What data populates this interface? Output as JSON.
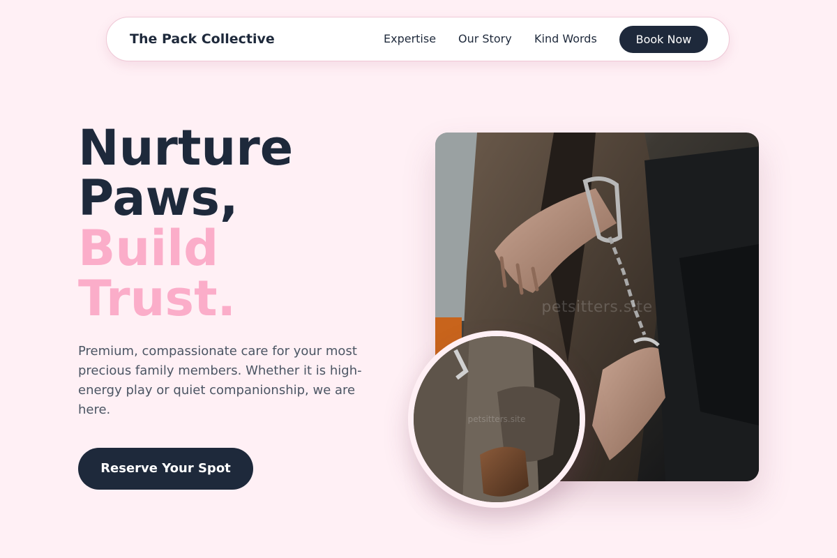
{
  "nav": {
    "brand": "The Pack Collective",
    "links": [
      {
        "label": "Expertise"
      },
      {
        "label": "Our Story"
      },
      {
        "label": "Kind Words"
      }
    ],
    "cta_label": "Book Now"
  },
  "hero": {
    "headline_lines": [
      "Nurture",
      "Paws,"
    ],
    "headline_accent_lines": [
      "Build",
      "Trust."
    ],
    "description": "Premium, compassionate care for your most precious family members. Whether it is high-energy play or quiet companionship, we are here.",
    "cta_label": "Reserve Your Spot"
  },
  "images": {
    "main_watermark": "petsitters.site",
    "circle_watermark": "petsitters.site"
  },
  "colors": {
    "background": "#fff0f5",
    "primary": "#1e293b",
    "accent": "#fbadc9",
    "body_text": "#4b5563"
  }
}
